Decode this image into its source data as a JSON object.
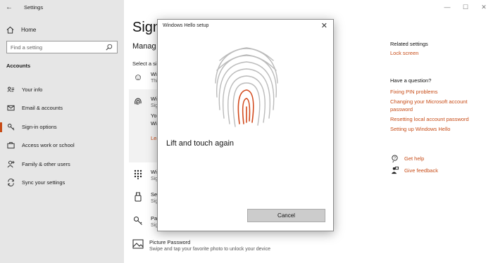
{
  "window": {
    "title": "Settings"
  },
  "sidebar": {
    "home_label": "Home",
    "search_placeholder": "Find a setting",
    "section_title": "Accounts",
    "items": [
      {
        "label": "Your info",
        "icon": "person-card-icon"
      },
      {
        "label": "Email & accounts",
        "icon": "mail-icon"
      },
      {
        "label": "Sign-in options",
        "icon": "key-icon",
        "active": true
      },
      {
        "label": "Access work or school",
        "icon": "briefcase-icon"
      },
      {
        "label": "Family & other users",
        "icon": "person-add-icon"
      },
      {
        "label": "Sync your settings",
        "icon": "sync-icon"
      }
    ]
  },
  "main": {
    "title": "Sign-",
    "subtitle": "Manag",
    "select_label": "Select a si",
    "options": [
      {
        "title": "Wi",
        "sub": "Thi",
        "icon": "face-icon"
      },
      {
        "title": "Wi",
        "sub": "Sig",
        "extra1": "You",
        "extra2": "Wi",
        "link": "Lea",
        "icon": "fingerprint-icon"
      },
      {
        "title": "Wi",
        "sub": "Sig",
        "icon": "pin-icon"
      },
      {
        "title": "Sec",
        "sub": "Sig",
        "icon": "usb-key-icon"
      },
      {
        "title": "Pas",
        "sub": "Sig",
        "icon": "password-key-icon"
      }
    ],
    "picture_password": {
      "title": "Picture Password",
      "sub": "Swipe and tap your favorite photo to unlock your device"
    }
  },
  "right": {
    "related_title": "Related settings",
    "related_links": [
      "Lock screen"
    ],
    "question_title": "Have a question?",
    "question_links": [
      "Fixing PIN problems",
      "Changing your Microsoft account password",
      "Resetting local account password",
      "Setting up Windows Hello"
    ],
    "get_help": "Get help",
    "give_feedback": "Give feedback"
  },
  "dialog": {
    "title": "Windows Hello setup",
    "message": "Lift and touch again",
    "cancel_label": "Cancel"
  },
  "colors": {
    "accent": "#c74b16",
    "sidebar_bg": "#e6e6e6"
  }
}
